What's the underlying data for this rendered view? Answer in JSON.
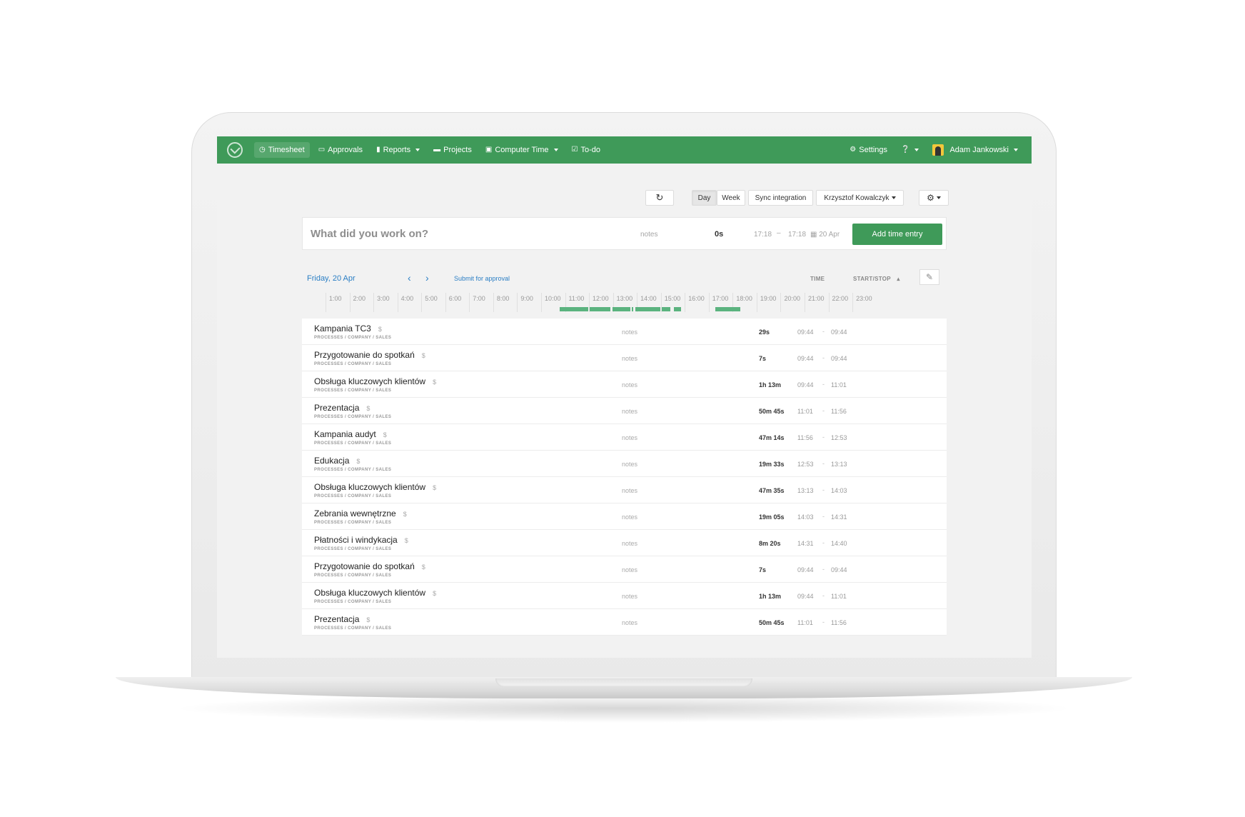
{
  "nav": {
    "items": [
      {
        "label": "Timesheet",
        "icon": "clock-icon"
      },
      {
        "label": "Approvals",
        "icon": "inbox-icon"
      },
      {
        "label": "Reports",
        "icon": "file-icon"
      },
      {
        "label": "Projects",
        "icon": "folder-icon"
      },
      {
        "label": "Computer Time",
        "icon": "laptop-icon"
      },
      {
        "label": "To-do",
        "icon": "check-square-icon"
      }
    ],
    "settings": "Settings",
    "user": "Adam Jankowski"
  },
  "toolbar": {
    "day": "Day",
    "week": "Week",
    "sync": "Sync integration",
    "person": "Krzysztof Kowalczyk"
  },
  "entry": {
    "placeholder": "What did you work on?",
    "notes": "notes",
    "duration": "0s",
    "start": "17:18",
    "dash": "–",
    "end": "17:18",
    "date": "20 Apr",
    "add": "Add time entry"
  },
  "day": {
    "title": "Friday, 20 Apr",
    "prev": "‹",
    "next": "›",
    "submit": "Submit for approval",
    "col_time": "TIME",
    "col_startstop": "START/STOP"
  },
  "timeline": {
    "hours": [
      "1:00",
      "2:00",
      "3:00",
      "4:00",
      "5:00",
      "6:00",
      "7:00",
      "8:00",
      "9:00",
      "10:00",
      "11:00",
      "12:00",
      "13:00",
      "14:00",
      "15:00",
      "16:00",
      "17:00",
      "18:00",
      "19:00",
      "20:00",
      "21:00",
      "22:00",
      "23:00"
    ]
  },
  "rows": [
    {
      "name": "Kampania TC3",
      "path": "PROCESSES / COMPANY / SALES",
      "notes": "notes",
      "duration": "29s",
      "start": "09:44",
      "stop": "09:44"
    },
    {
      "name": "Przygotowanie do spotkań",
      "path": "PROCESSES / COMPANY / SALES",
      "notes": "notes",
      "duration": "7s",
      "start": "09:44",
      "stop": "09:44"
    },
    {
      "name": "Obsługa kluczowych klientów",
      "path": "PROCESSES / COMPANY / SALES",
      "notes": "notes",
      "duration": "1h 13m",
      "start": "09:44",
      "stop": "11:01"
    },
    {
      "name": "Prezentacja",
      "path": "PROCESSES / COMPANY / SALES",
      "notes": "notes",
      "duration": "50m 45s",
      "start": "11:01",
      "stop": "11:56"
    },
    {
      "name": "Kampania audyt",
      "path": "PROCESSES / COMPANY / SALES",
      "notes": "notes",
      "duration": "47m 14s",
      "start": "11:56",
      "stop": "12:53"
    },
    {
      "name": "Edukacja",
      "path": "PROCESSES / COMPANY / SALES",
      "notes": "notes",
      "duration": "19m 33s",
      "start": "12:53",
      "stop": "13:13"
    },
    {
      "name": "Obsługa kluczowych klientów",
      "path": "PROCESSES / COMPANY / SALES",
      "notes": "notes",
      "duration": "47m 35s",
      "start": "13:13",
      "stop": "14:03"
    },
    {
      "name": "Zebrania wewnętrzne",
      "path": "PROCESSES / COMPANY / SALES",
      "notes": "notes",
      "duration": "19m 05s",
      "start": "14:03",
      "stop": "14:31"
    },
    {
      "name": "Płatności i windykacja",
      "path": "PROCESSES / COMPANY / SALES",
      "notes": "notes",
      "duration": "8m 20s",
      "start": "14:31",
      "stop": "14:40"
    },
    {
      "name": "Przygotowanie do spotkań",
      "path": "PROCESSES / COMPANY / SALES",
      "notes": "notes",
      "duration": "7s",
      "start": "09:44",
      "stop": "09:44"
    },
    {
      "name": "Obsługa kluczowych klientów",
      "path": "PROCESSES / COMPANY / SALES",
      "notes": "notes",
      "duration": "1h 13m",
      "start": "09:44",
      "stop": "11:01"
    },
    {
      "name": "Prezentacja",
      "path": "PROCESSES / COMPANY / SALES",
      "notes": "notes",
      "duration": "50m 45s",
      "start": "11:01",
      "stop": "11:56"
    }
  ],
  "colors": {
    "brand": "#3f9a59",
    "link": "#2a7ec4",
    "bar": "#5bb37f"
  }
}
